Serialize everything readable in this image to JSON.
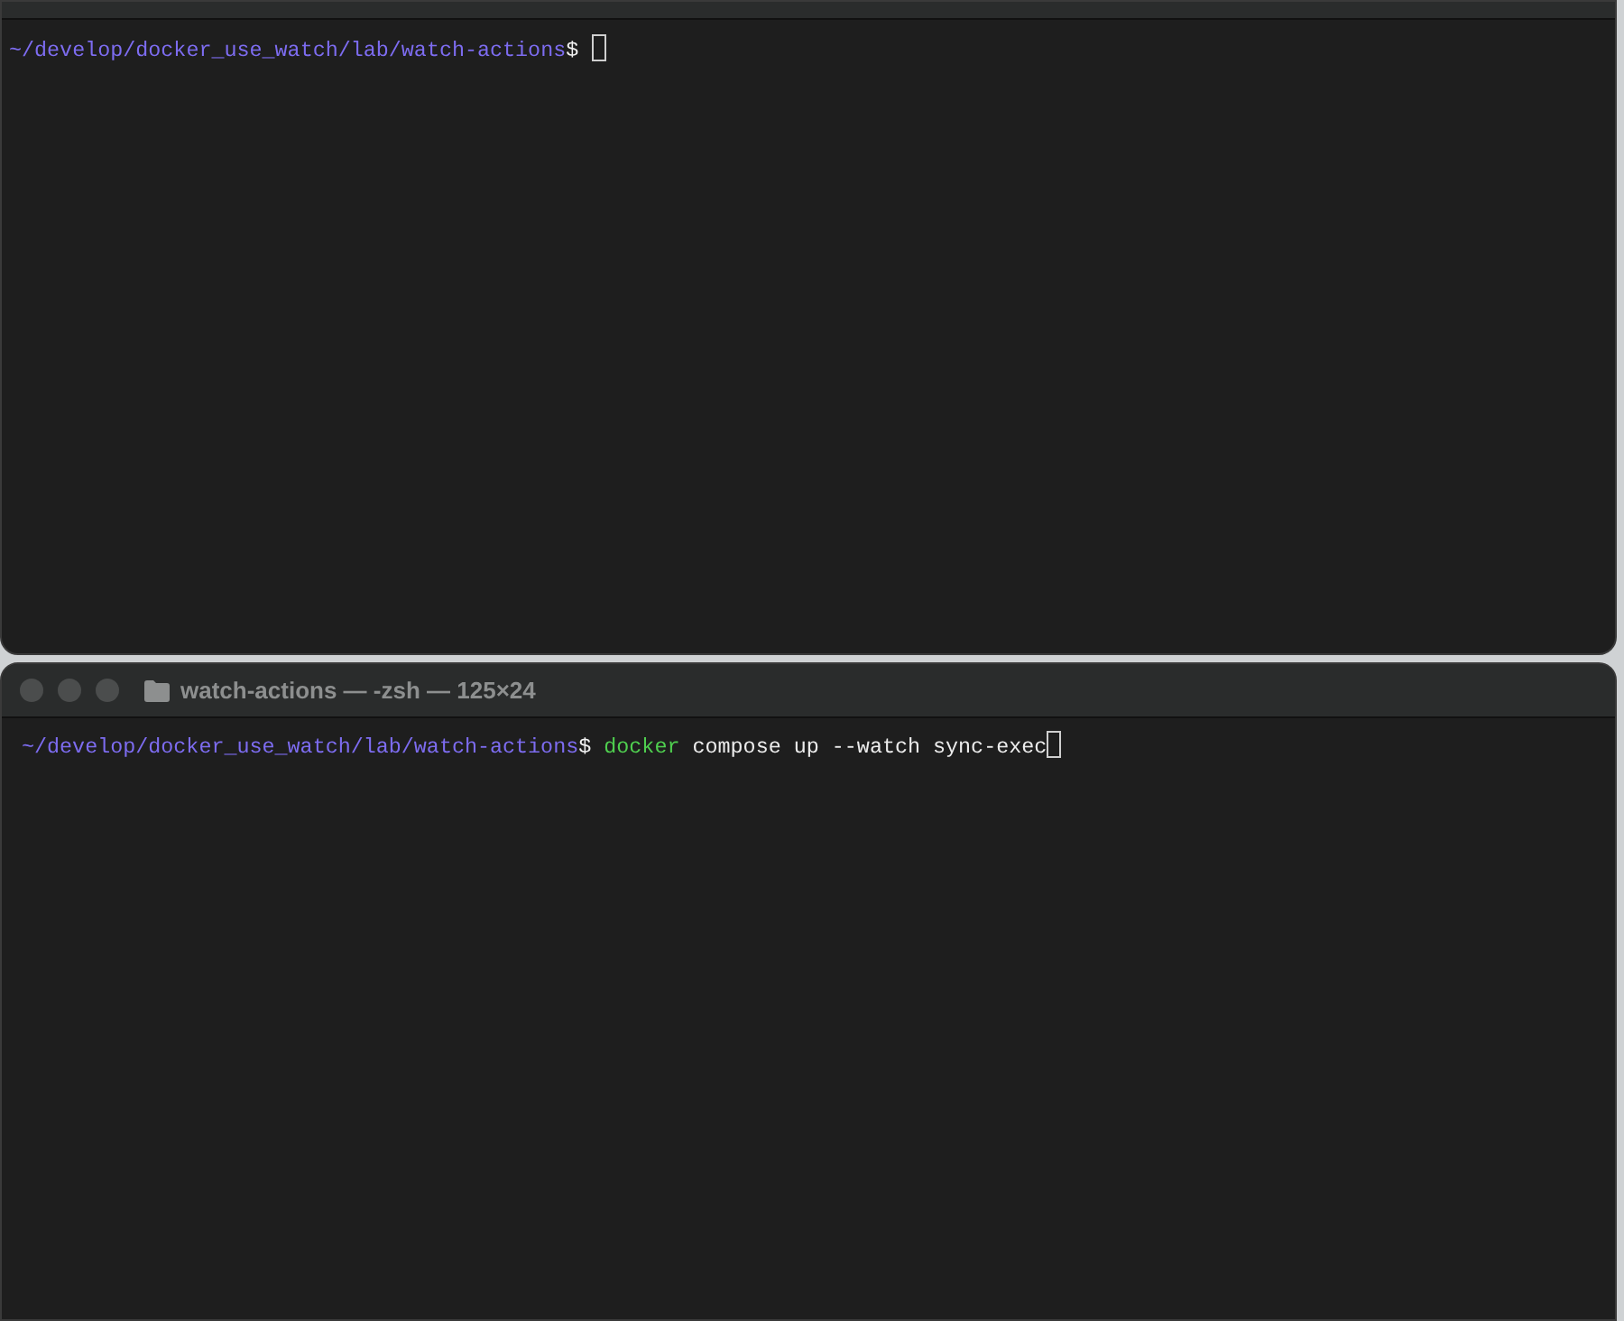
{
  "top_terminal": {
    "lines": [
      {
        "prompt": "~/develop/docker_use_watch/lab/watch-actions",
        "symbol": "$"
      }
    ]
  },
  "bottom_terminal": {
    "title": "watch-actions — -zsh — 125×24",
    "lines": [
      {
        "prompt": "~/develop/docker_use_watch/lab/watch-actions",
        "symbol": "$",
        "parts": [
          {
            "kind": "command",
            "text": "docker"
          },
          {
            "kind": "argument",
            "text": "compose up --watch sync-exec"
          }
        ]
      }
    ]
  }
}
